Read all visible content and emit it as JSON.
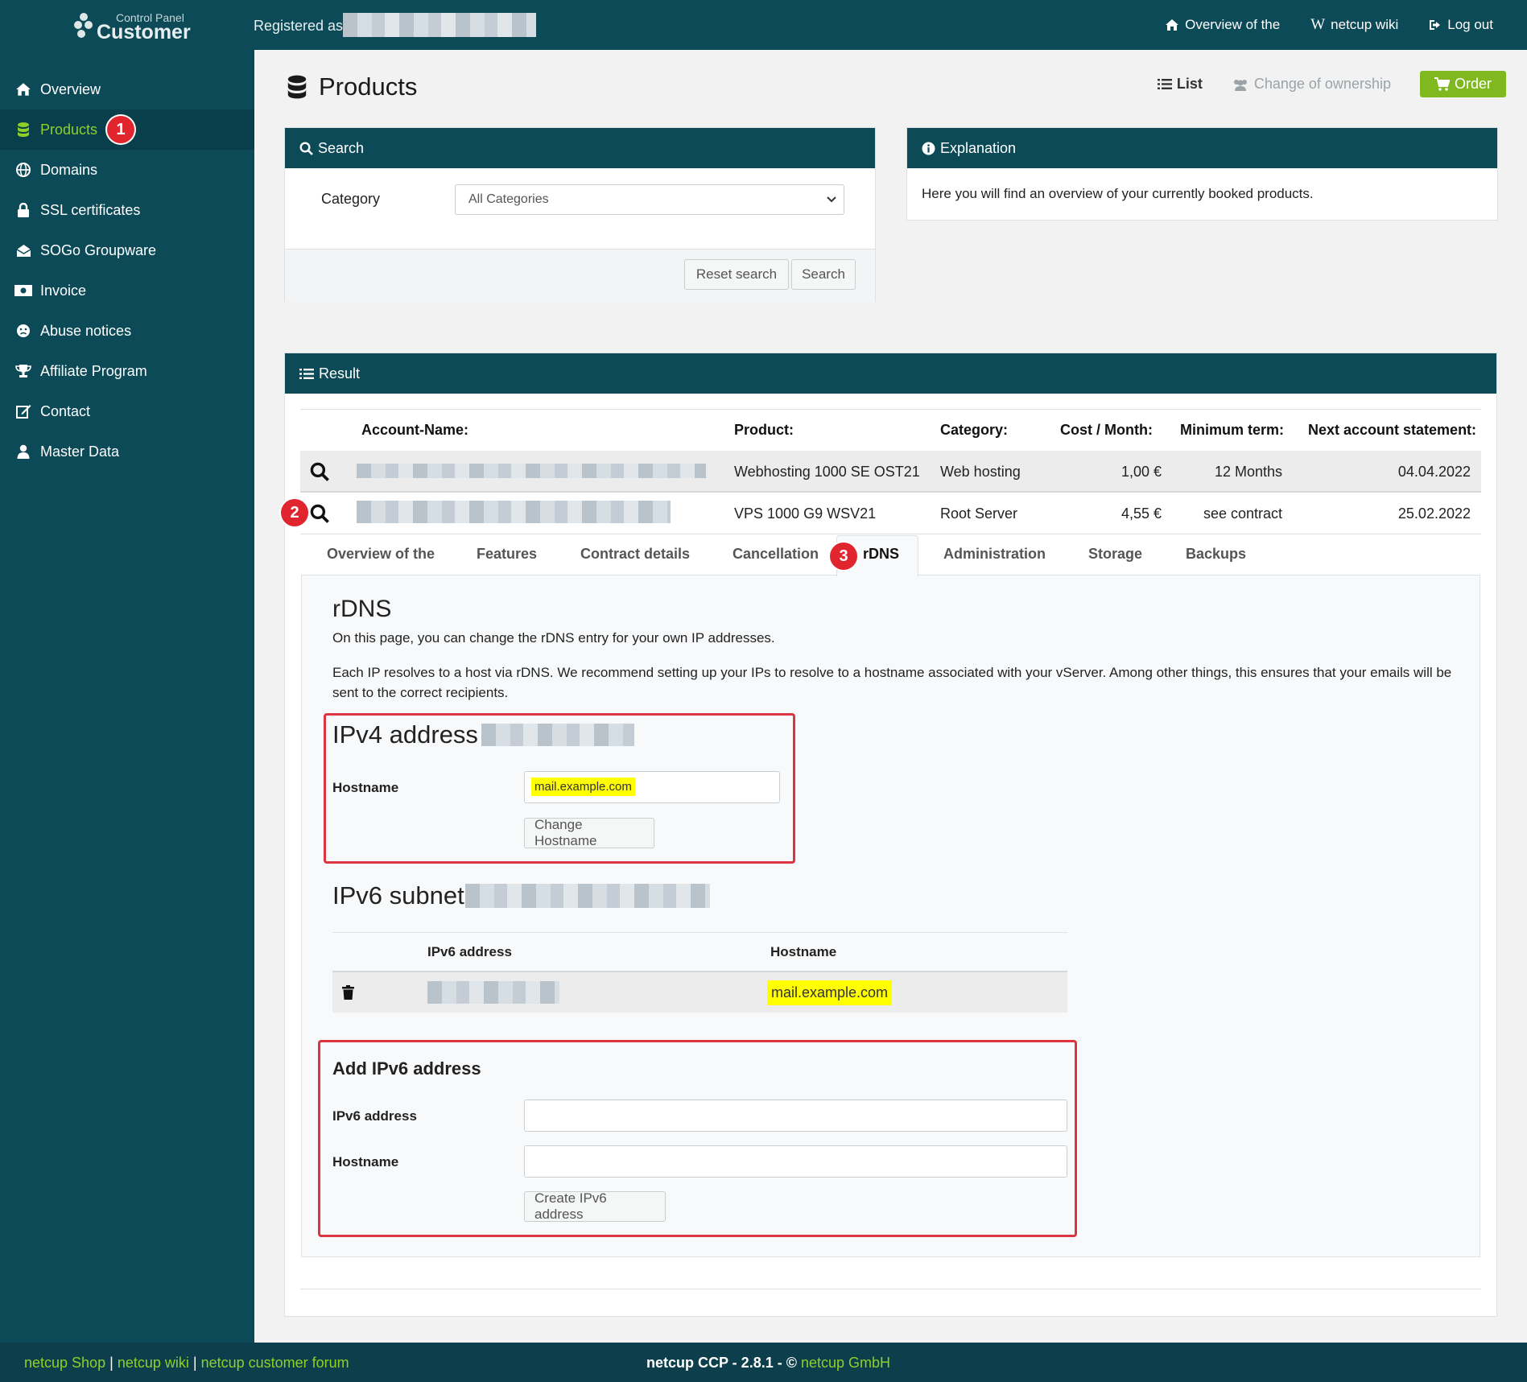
{
  "header": {
    "logo_small": "Control Panel",
    "logo_big": "Customer",
    "registered_label": "Registered as",
    "links": [
      "Overview of the",
      "netcup wiki",
      "Log out"
    ]
  },
  "sidebar": {
    "items": [
      {
        "label": "Overview",
        "icon": "home-icon"
      },
      {
        "label": "Products",
        "icon": "database-icon",
        "active": true,
        "badge": "1"
      },
      {
        "label": "Domains",
        "icon": "globe-icon"
      },
      {
        "label": "SSL certificates",
        "icon": "lock-icon"
      },
      {
        "label": "SOGo Groupware",
        "icon": "envelope-open-icon"
      },
      {
        "label": "Invoice",
        "icon": "money-icon"
      },
      {
        "label": "Abuse notices",
        "icon": "frown-icon"
      },
      {
        "label": "Affiliate Program",
        "icon": "trophy-icon"
      },
      {
        "label": "Contact",
        "icon": "edit-icon"
      },
      {
        "label": "Master Data",
        "icon": "user-icon"
      }
    ]
  },
  "page": {
    "title": "Products",
    "actions": {
      "list": "List",
      "owner": "Change of ownership",
      "order": "Order"
    }
  },
  "search_panel": {
    "title": "Search",
    "category_label": "Category",
    "category_value": "All Categories",
    "reset_label": "Reset search",
    "search_label": "Search"
  },
  "explanation_panel": {
    "title": "Explanation",
    "text": "Here you will find an overview of your currently booked products."
  },
  "result_panel": {
    "title": "Result",
    "columns": [
      "Account-Name:",
      "Product:",
      "Category:",
      "Cost / Month:",
      "Minimum term:",
      "Next account statement:"
    ],
    "rows": [
      {
        "product": "Webhosting 1000 SE OST21",
        "category": "Web hosting",
        "cost": "1,00 €",
        "term": "12 Months",
        "next": "04.04.2022"
      },
      {
        "product": "VPS 1000 G9 WSV21",
        "category": "Root Server",
        "cost": "4,55 €",
        "term": "see contract",
        "next": "25.02.2022",
        "badge": "2"
      }
    ],
    "tabs": [
      "Overview of the",
      "Features",
      "Contract details",
      "Cancellation",
      "rDNS",
      "Administration",
      "Storage",
      "Backups"
    ],
    "active_tab_badge": "3"
  },
  "rdns": {
    "title": "rDNS",
    "intro": "On this page, you can change the rDNS entry for your own IP addresses.",
    "description": "Each IP resolves to a host via rDNS. We recommend setting up your IPs to resolve to a hostname associated with your vServer. Among other things, this ensures that your emails will be sent to the correct recipients.",
    "ipv4_title": "IPv4 address",
    "hostname_label": "Hostname",
    "ipv4_hostname_value": "mail.example.com",
    "change_hostname_label": "Change Hostname",
    "ipv6_title": "IPv6 subnet",
    "ipv6_table_headers": [
      "IPv6 address",
      "Hostname"
    ],
    "ipv6_rows": [
      {
        "hostname": "mail.example.com"
      }
    ],
    "add_title": "Add IPv6 address",
    "add_ipv6_label": "IPv6 address",
    "add_hostname_label": "Hostname",
    "create_label": "Create IPv6 address"
  },
  "footer": {
    "shop": "netcup Shop",
    "wiki": "netcup wiki",
    "forum": "netcup customer forum",
    "sep": "|",
    "version": "netcup CCP - 2.8.1 - ©",
    "company": "netcup GmbH"
  },
  "colors": {
    "primary": "#0c4a57",
    "accent_green": "#8fcf2a",
    "order_green": "#7fb81f",
    "badge_red": "#e0252e",
    "highlight_yellow": "#ffff00"
  }
}
